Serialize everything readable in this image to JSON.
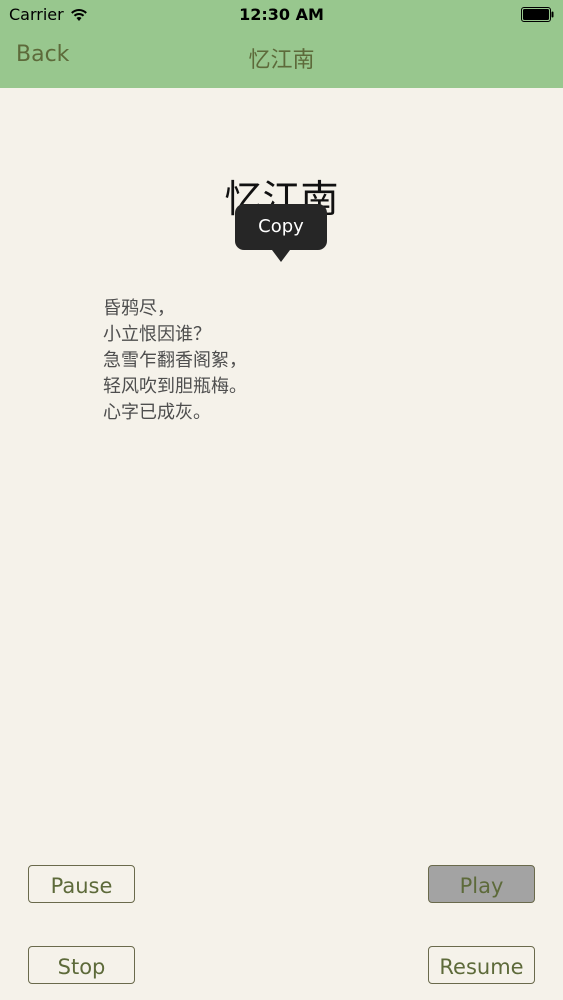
{
  "status_bar": {
    "carrier": "Carrier",
    "time": "12:30 AM"
  },
  "nav": {
    "back_label": "Back",
    "title": "忆江南"
  },
  "poem": {
    "title": "忆江南",
    "lines": [
      "昏鸦尽，",
      "小立恨因谁？",
      "急雪乍翻香阁絮，",
      "轻风吹到胆瓶梅。",
      "心字已成灰。"
    ]
  },
  "tooltip": {
    "label": "Copy"
  },
  "controls": {
    "pause": "Pause",
    "play": "Play",
    "stop": "Stop",
    "resume": "Resume"
  },
  "colors": {
    "nav_bar": "#98c78e",
    "background": "#f5f2ea",
    "accent_text": "#5d6a3a",
    "play_button_active": "#a3a3a3"
  }
}
